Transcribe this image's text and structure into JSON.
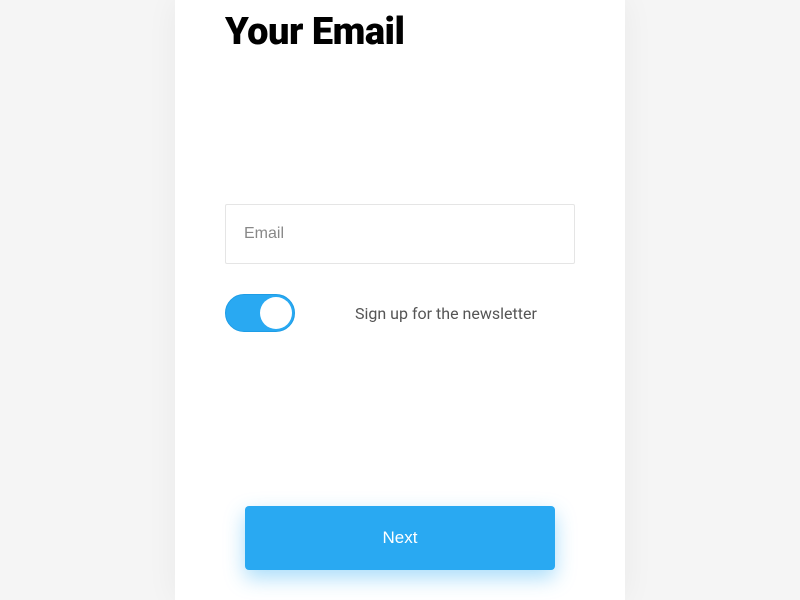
{
  "title": "Your Email",
  "form": {
    "email_placeholder": "Email",
    "newsletter_label": "Sign up for the newsletter",
    "newsletter_enabled": true
  },
  "actions": {
    "next_label": "Next"
  },
  "colors": {
    "accent": "#29a9f2"
  }
}
